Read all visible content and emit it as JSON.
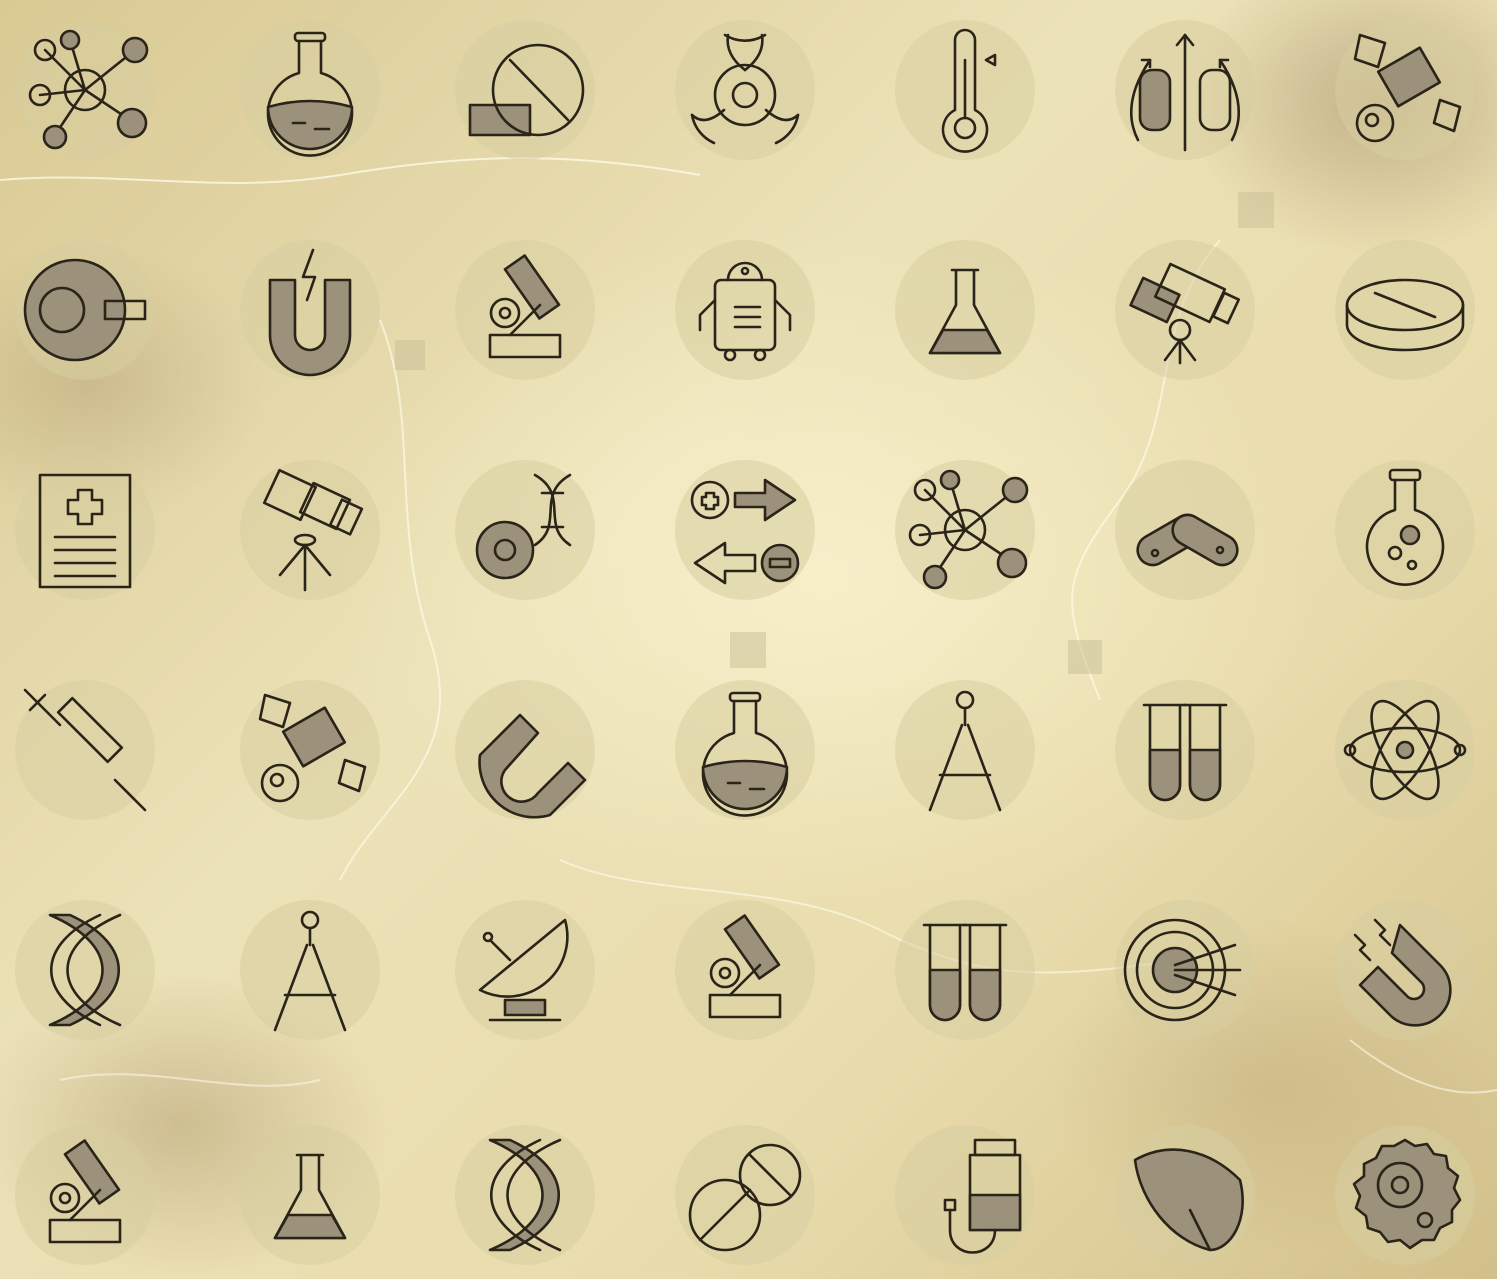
{
  "sheet": {
    "background_color": "#e7dcb0",
    "line_color": "#2a2419",
    "fill_color": "#9c917a"
  },
  "icons": [
    [
      "molecule-icon",
      "round-flask-icon",
      "pill-icon",
      "biohazard-icon",
      "thermometer-icon",
      "rotation-arrows-icon",
      "satellite-icon"
    ],
    [
      "lens-ring-icon",
      "magnet-lightning-icon",
      "microscope-icon",
      "robot-icon",
      "conical-flask-icon",
      "telescope-icon",
      "tablet-disc-icon"
    ],
    [
      "medical-report-icon",
      "telescope-tripod-icon",
      "gear-dna-icon",
      "plus-minus-arrows-icon",
      "molecule-icon",
      "capsules-icon",
      "flask-bubbles-icon"
    ],
    [
      "syringe-icon",
      "satellite-icon",
      "horseshoe-magnet-icon",
      "round-flask-icon",
      "drawing-compass-icon",
      "test-tubes-icon",
      "atom-icon"
    ],
    [
      "dna-icon",
      "drawing-compass-icon",
      "satellite-dish-icon",
      "microscope-icon",
      "test-tubes-icon",
      "target-icon",
      "magnet-icon"
    ],
    [
      "microscope-icon",
      "conical-flask-icon",
      "dna-icon",
      "pills-icon",
      "iv-drip-icon",
      "liver-icon",
      "cell-icon"
    ]
  ]
}
